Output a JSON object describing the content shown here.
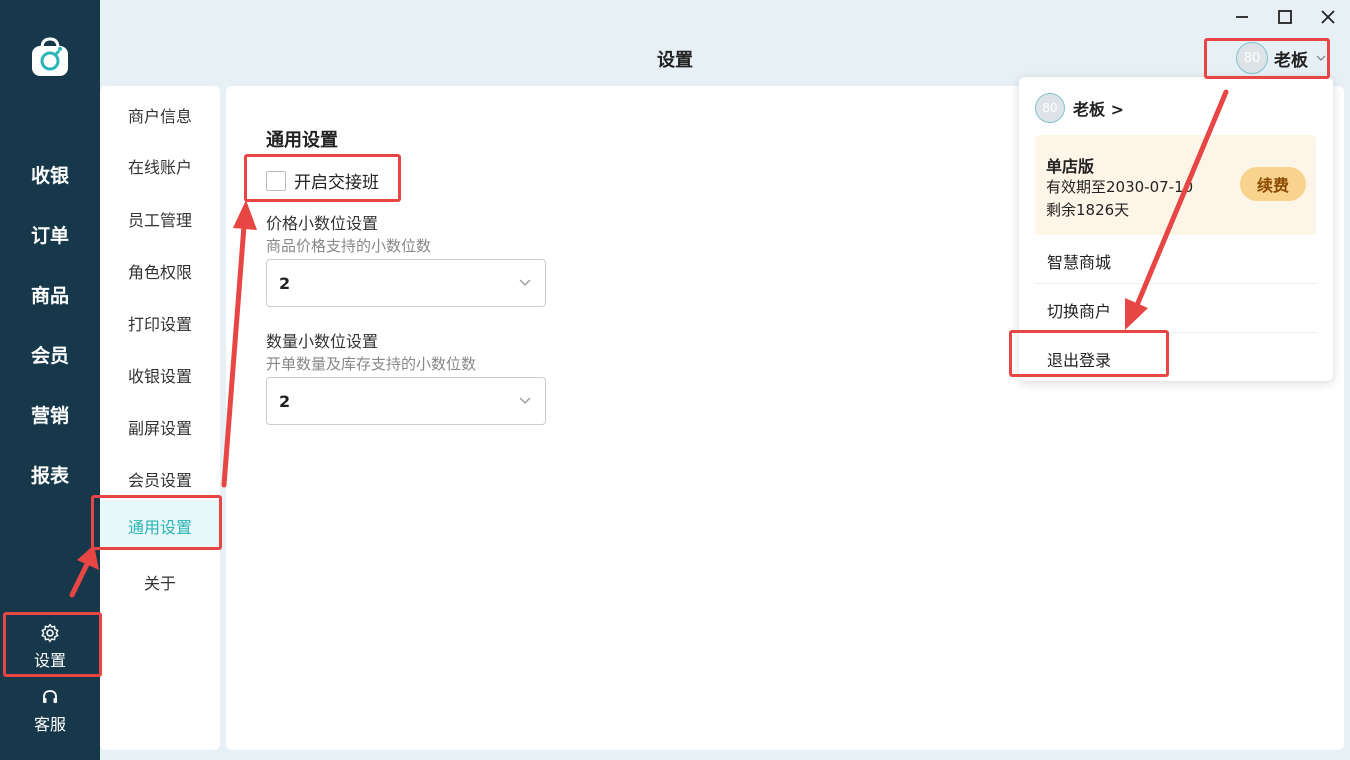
{
  "header": {
    "title": "设置"
  },
  "user": {
    "avatar_text": "80",
    "name": "老板"
  },
  "leftnav": {
    "items": [
      {
        "label": "收银"
      },
      {
        "label": "订单"
      },
      {
        "label": "商品"
      },
      {
        "label": "会员"
      },
      {
        "label": "营销"
      },
      {
        "label": "报表"
      }
    ],
    "settings_label": "设置",
    "support_label": "客服"
  },
  "submenu": {
    "items": [
      {
        "label": "商户信息"
      },
      {
        "label": "在线账户"
      },
      {
        "label": "员工管理"
      },
      {
        "label": "角色权限"
      },
      {
        "label": "打印设置"
      },
      {
        "label": "收银设置"
      },
      {
        "label": "副屏设置"
      },
      {
        "label": "会员设置"
      },
      {
        "label": "通用设置"
      },
      {
        "label": "关于"
      }
    ],
    "active": "通用设置"
  },
  "main": {
    "section_title": "通用设置",
    "shift_checkbox": {
      "label": "开启交接班",
      "checked": false
    },
    "price_decimal": {
      "label": "价格小数位设置",
      "hint": "商品价格支持的小数位数",
      "value": "2"
    },
    "qty_decimal": {
      "label": "数量小数位设置",
      "hint": "开单数量及库存支持的小数位数",
      "value": "2"
    }
  },
  "dropdown": {
    "user_link": "老板 >",
    "plan": {
      "name": "单店版",
      "expire": "有效期至2030-07-10",
      "remain": "剩余1826天",
      "renew_label": "续费"
    },
    "items": [
      {
        "label": "智慧商城"
      },
      {
        "label": "切换商户"
      },
      {
        "label": "退出登录"
      }
    ]
  },
  "colors": {
    "nav_bg": "#17384a",
    "accent": "#2bb5b5",
    "highlight": "#e84545",
    "renew_bg": "#f8d38e",
    "plan_bg": "#fdf6e8"
  },
  "icons": {
    "logo": "shopping-bag-logo-icon",
    "settings": "gear-icon",
    "support": "headset-icon",
    "chevron": "chevron-down-icon"
  }
}
